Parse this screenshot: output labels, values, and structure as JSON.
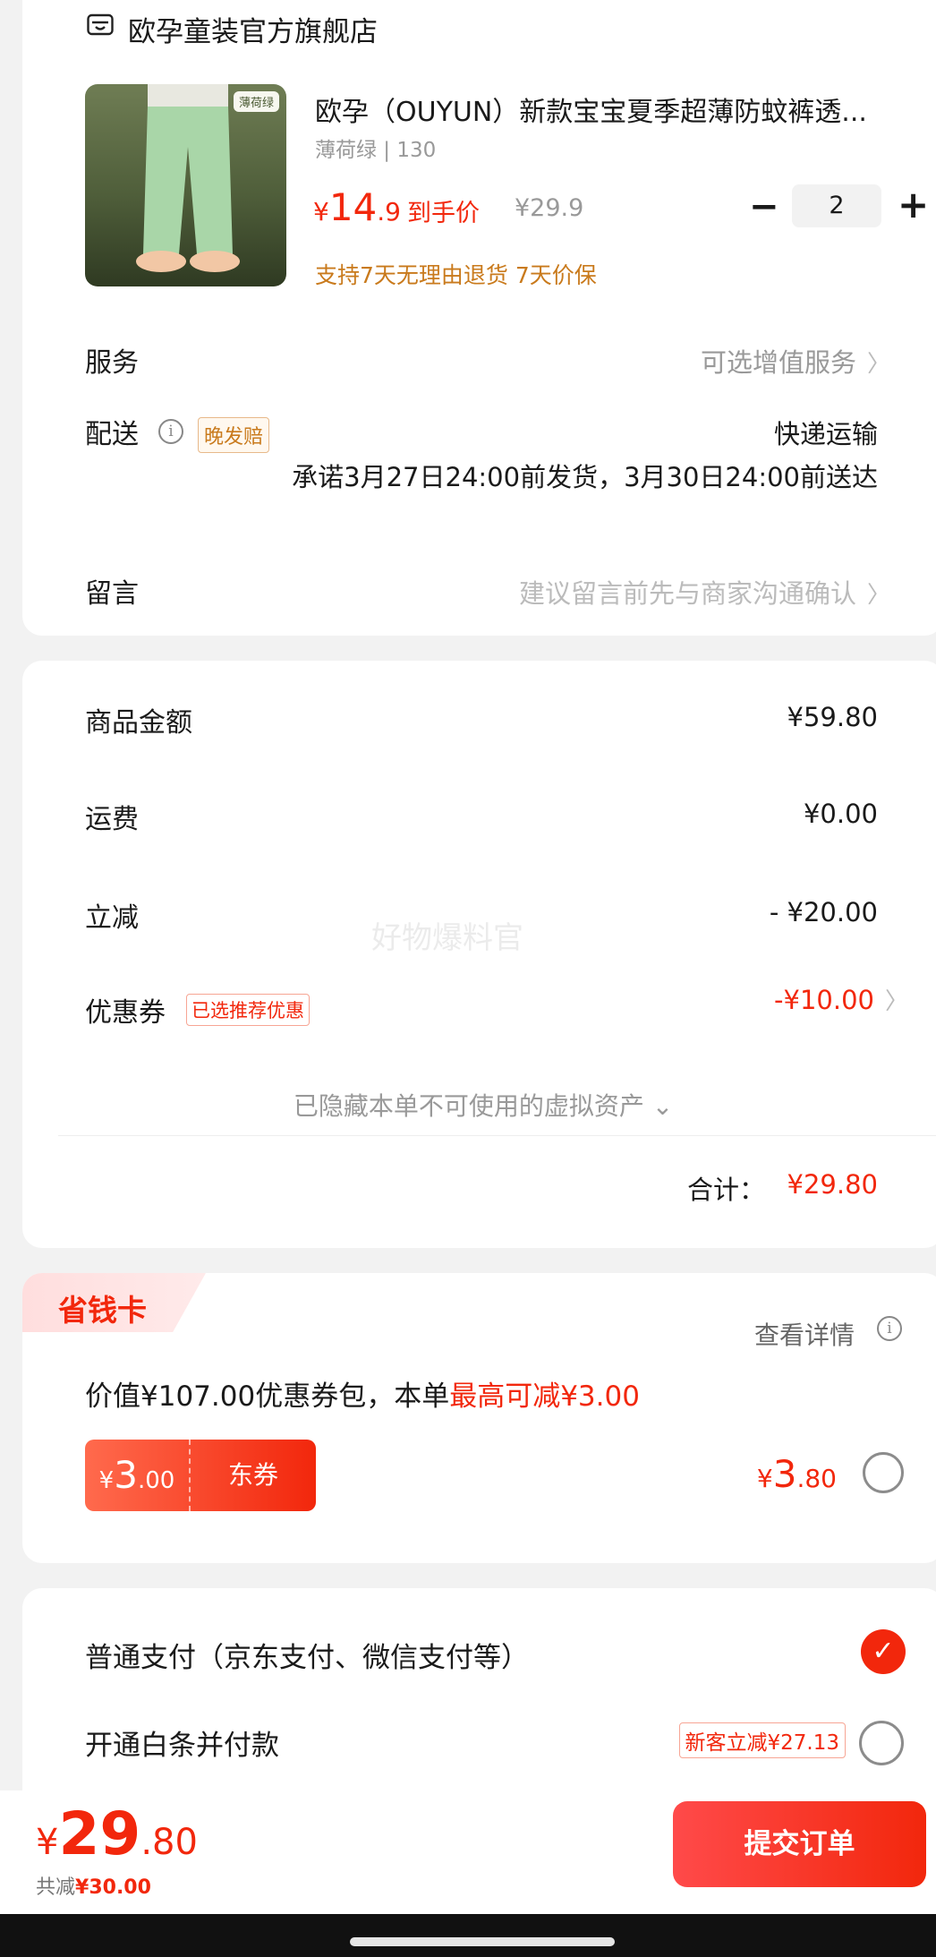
{
  "store": {
    "name": "欧孕童装官方旗舰店",
    "product": {
      "title": "欧孕（OUYUN）新款宝宝夏季超薄防蚊裤透...",
      "variant": "薄荷绿 | 130",
      "thumb_tag": "薄荷绿",
      "price_symbol": "¥",
      "price_int": "14",
      "price_dec": ".9",
      "price_label": "到手价",
      "original_price": "¥29.9",
      "guarantee": "支持7天无理由退货  7天价保",
      "quantity": "2",
      "minus": "−",
      "plus": "+"
    },
    "service": {
      "label": "服务",
      "value": "可选增值服务"
    },
    "delivery": {
      "label": "配送",
      "info_icon": "i",
      "badge": "晚发赔",
      "method": "快递运输",
      "promise": "承诺3月27日24:00前发货，3月30日24:00前送达"
    },
    "message": {
      "label": "留言",
      "placeholder": "建议留言前先与商家沟通确认"
    },
    "chevron": "〉"
  },
  "amount": {
    "goods": {
      "label": "商品金额",
      "value": "¥59.80"
    },
    "shipping": {
      "label": "运费",
      "value": "¥0.00"
    },
    "instant_discount": {
      "label": "立减",
      "value": "- ¥20.00"
    },
    "coupon": {
      "label": "优惠券",
      "badge": "已选推荐优惠",
      "value": "-¥10.00"
    },
    "hidden_assets": "已隐藏本单不可使用的虚拟资产 ⌄",
    "total_label": "合计：",
    "total_value": "¥29.80",
    "watermark": "好物爆料官"
  },
  "saver_card": {
    "title": "省钱卡",
    "details": "查看详情",
    "info_icon": "i",
    "desc_prefix": "价值¥107.00优惠券包，本单",
    "desc_highlight": "最高可减¥3.00",
    "coupon_symbol": "¥",
    "coupon_int": "3",
    "coupon_dec": ".00",
    "coupon_type": "东券",
    "price_symbol": "¥",
    "price_int": "3",
    "price_dec": ".80"
  },
  "payment": {
    "normal": {
      "label": "普通支付（京东支付、微信支付等）",
      "selected": true
    },
    "baitiao": {
      "label": "开通白条并付款",
      "badge": "新客立减¥27.13",
      "selected": false
    },
    "check": "✓"
  },
  "bottom_bar": {
    "price_symbol": "¥",
    "price_int": "29",
    "price_dec": ".80",
    "discount_prefix": "共减",
    "discount_value": "¥30.00",
    "submit_label": "提交订单"
  },
  "colors": {
    "accent": "#f2270c",
    "orange": "#c97a1c",
    "background": "#f2f2f2"
  }
}
